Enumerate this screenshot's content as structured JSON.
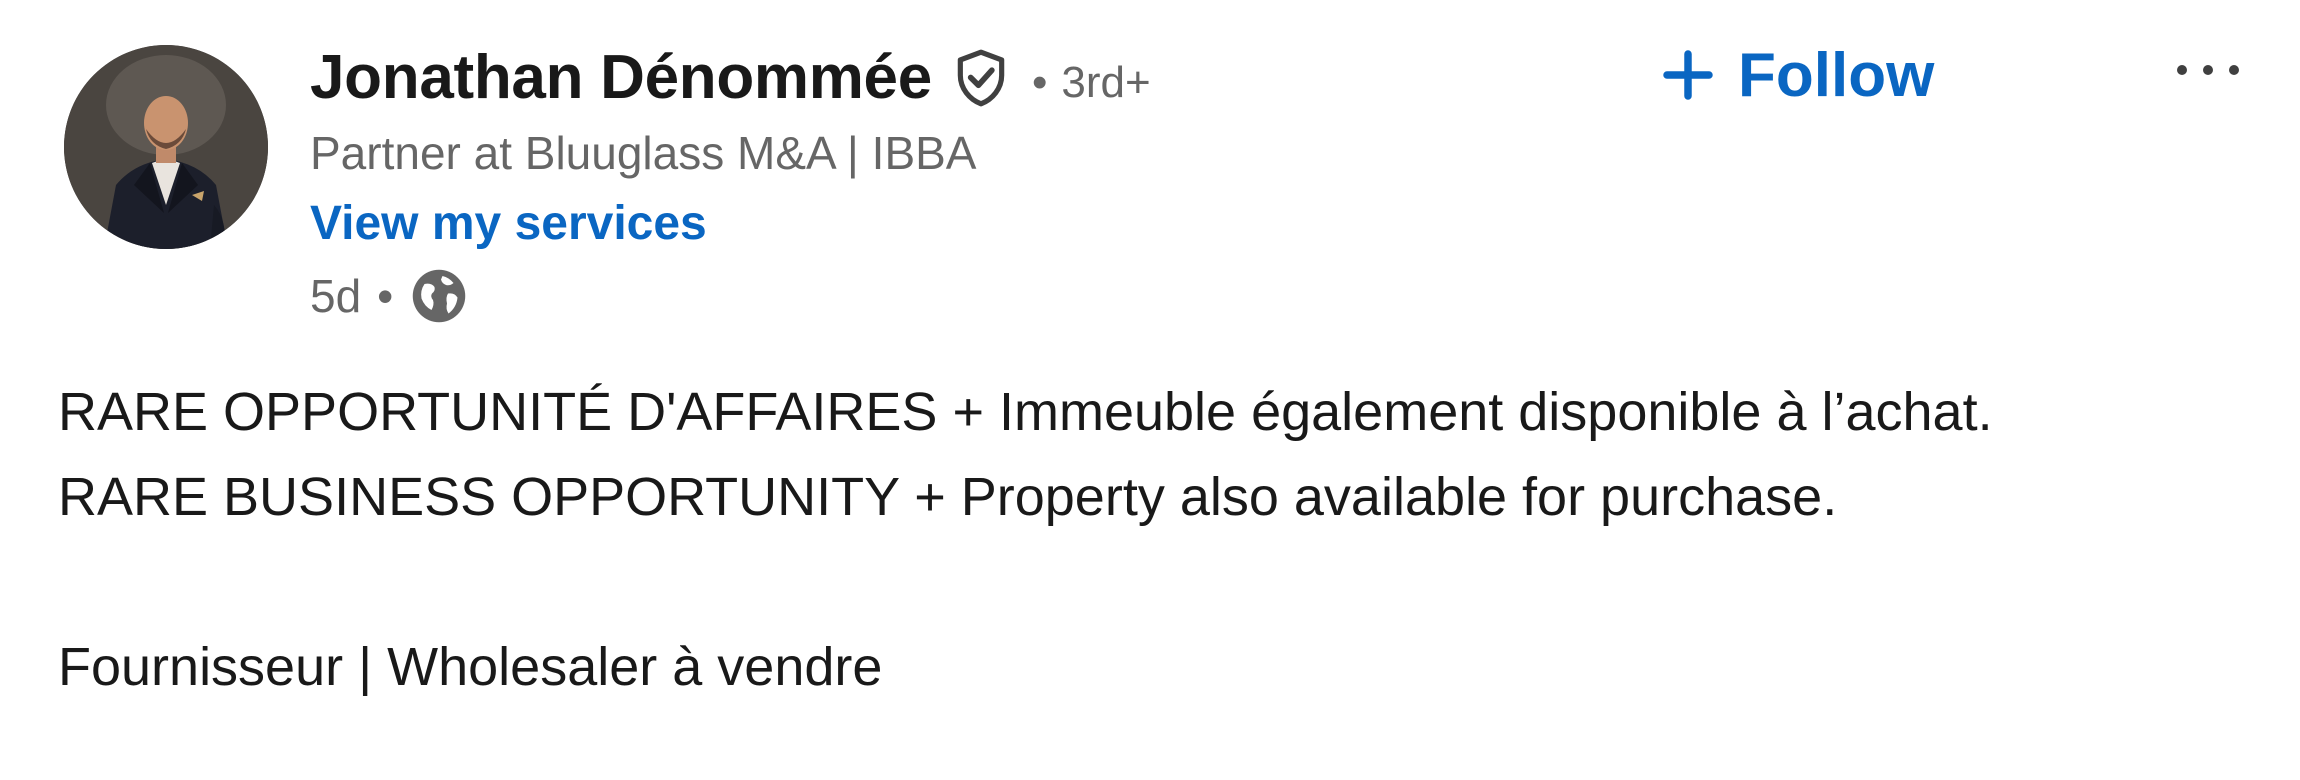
{
  "post": {
    "actor": {
      "name": "Jonathan Dénommée",
      "degree": "3rd+",
      "degree_separator": "•",
      "headline": "Partner at Bluuglass M&A | IBBA",
      "services_link": "View my services",
      "time_ago": "5d",
      "meta_separator": "•",
      "avatar_icon": "profile-photo",
      "verified_icon": "verified-shield-icon",
      "visibility_icon": "globe-icon"
    },
    "follow_button": {
      "label": "Follow",
      "icon": "plus-icon"
    },
    "more_button": {
      "icon": "ellipsis-icon"
    },
    "commentary": {
      "line1": "RARE OPPORTUNITÉ D'AFFAIRES + Immeuble également disponible à l’achat.",
      "line2": "RARE BUSINESS OPPORTUNITY + Property also available for purchase.",
      "line3": "Fournisseur | Wholesaler à vendre"
    }
  },
  "colors": {
    "link_blue": "#0a66c2",
    "text_primary": "rgba(0,0,0,0.9)",
    "text_secondary": "rgba(0,0,0,0.6)",
    "background": "#ffffff"
  }
}
